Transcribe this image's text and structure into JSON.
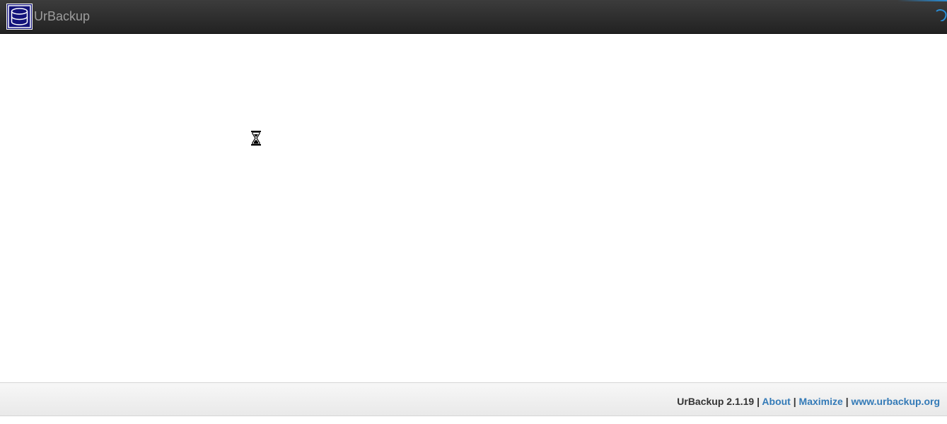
{
  "navbar": {
    "brand": "UrBackup",
    "logo_icon": "database-icon",
    "loading_icon": "spinner-icon",
    "accent_color": "#2a8ed6"
  },
  "content": {
    "loading_indicator_icon": "hourglass-icon"
  },
  "footer": {
    "version": "UrBackup 2.1.19",
    "separator": "|",
    "links": [
      "About",
      "Maximize",
      "www.urbackup.org"
    ],
    "link_color": "#337ab7"
  }
}
